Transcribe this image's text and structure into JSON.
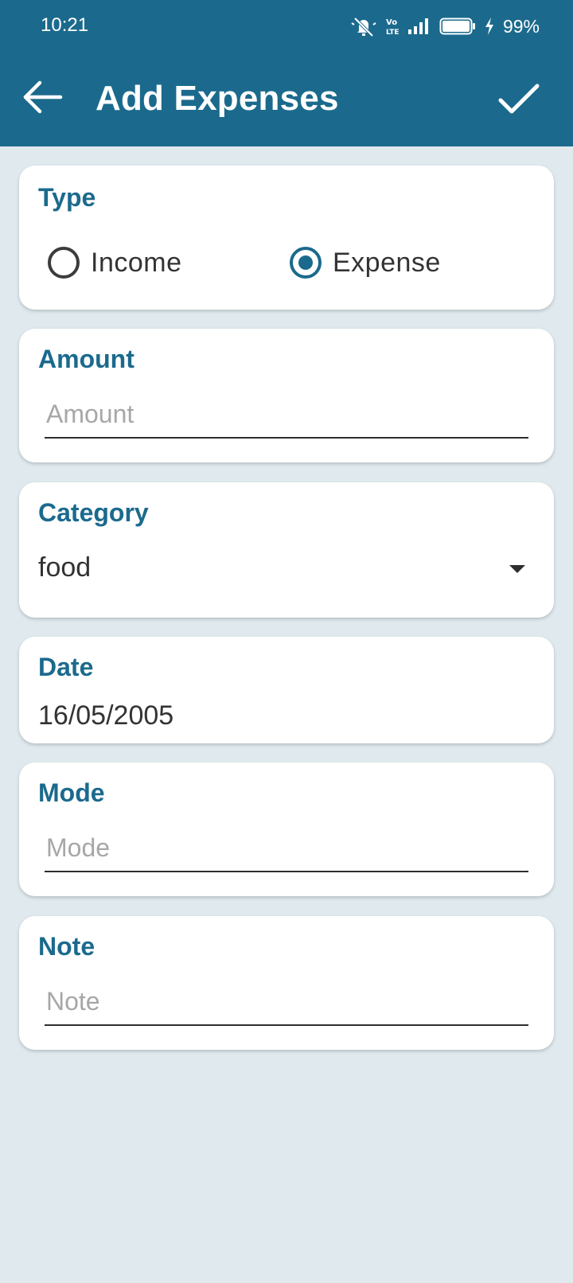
{
  "status_bar": {
    "time": "10:21",
    "volte": "Vo\nLTE",
    "battery": "99%"
  },
  "header": {
    "title": "Add Expenses",
    "back_icon": "arrow-left-icon",
    "confirm_icon": "checkmark-icon"
  },
  "type_card": {
    "label": "Type",
    "options": [
      {
        "label": "Income",
        "selected": false
      },
      {
        "label": "Expense",
        "selected": true
      }
    ]
  },
  "amount_card": {
    "label": "Amount",
    "placeholder": "Amount",
    "value": ""
  },
  "category_card": {
    "label": "Category",
    "value": "food"
  },
  "date_card": {
    "label": "Date",
    "value": "16/05/2005"
  },
  "mode_card": {
    "label": "Mode",
    "placeholder": "Mode",
    "value": ""
  },
  "note_card": {
    "label": "Note",
    "placeholder": "Note",
    "value": ""
  },
  "colors": {
    "primary": "#1b6a8d",
    "background": "#dfe9ee",
    "card": "#ffffff"
  }
}
